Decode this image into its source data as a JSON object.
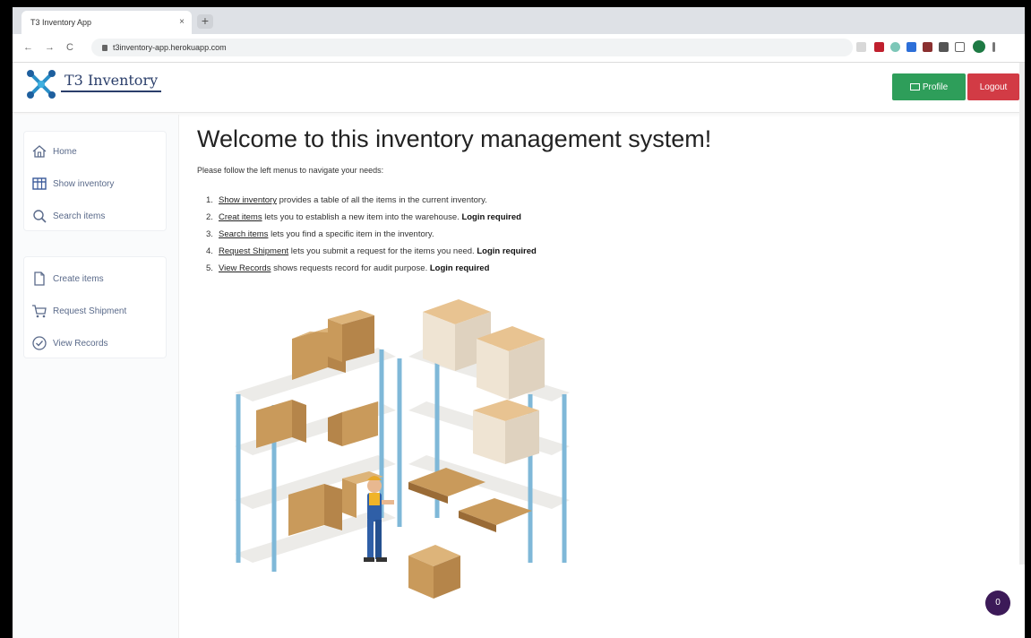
{
  "browser": {
    "tab_title": "T3 Inventory App",
    "tab_close": "×",
    "new_tab": "+",
    "url": "t3inventory-app.herokuapp.com",
    "back": "←",
    "forward": "→",
    "reload": "C"
  },
  "navbar": {
    "brand": "T3 Inventory",
    "profile_label": "Profile",
    "logout_label": "Logout"
  },
  "sidebar": {
    "items": [
      {
        "label": "Home",
        "icon": "home-icon"
      },
      {
        "label": "Show inventory",
        "icon": "table-icon"
      },
      {
        "label": "Search items",
        "icon": "search-icon"
      },
      {
        "label": "Create items",
        "icon": "file-icon"
      },
      {
        "label": "Request Shipment",
        "icon": "cart-icon"
      },
      {
        "label": "View Records",
        "icon": "check-circle-icon"
      }
    ]
  },
  "main": {
    "title": "Welcome to this inventory management system!",
    "subtitle": "Please follow the left menus to navigate your needs:",
    "list": [
      {
        "num": "1.",
        "link": "Show inventory",
        "text": " provides a table of all the items in the current inventory.",
        "req": ""
      },
      {
        "num": "2.",
        "link": "Creat items",
        "text": " lets you to establish a new item into the warehouse. ",
        "req": "Login required"
      },
      {
        "num": "3.",
        "link": "Search items",
        "text": " lets you find a specific item in the inventory.",
        "req": ""
      },
      {
        "num": "4.",
        "link": "Request Shipment",
        "text": " lets you submit a request for the items you need. ",
        "req": "Login required"
      },
      {
        "num": "5.",
        "link": "View Records",
        "text": " shows requests record for audit purpose. ",
        "req": "Login required"
      }
    ]
  },
  "badge": "0",
  "colors": {
    "profile": "#2e9e5a",
    "logout": "#d23b45",
    "brand": "#2a3e6a",
    "badge": "#3c1a58"
  }
}
